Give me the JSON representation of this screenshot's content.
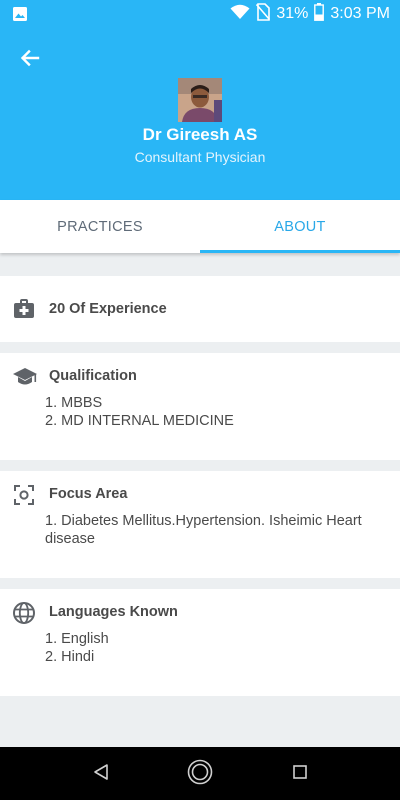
{
  "status_bar": {
    "battery": "31%",
    "time": "3:03 PM",
    "icons": [
      "image-icon",
      "wifi-icon",
      "no-sim-icon",
      "battery-icon"
    ]
  },
  "header": {
    "back_icon": "arrow-left-icon",
    "doctor_name": "Dr Gireesh AS",
    "doctor_title": "Consultant Physician",
    "background_color": "#29b6f6"
  },
  "tabs": [
    {
      "label": "PRACTICES",
      "active": false
    },
    {
      "label": "ABOUT",
      "active": true
    }
  ],
  "about": {
    "experience": {
      "icon": "medical-kit-icon",
      "text": "20 Of Experience"
    },
    "qualification": {
      "icon": "graduation-cap-icon",
      "title": "Qualification",
      "items": [
        "1. MBBS",
        "2. MD INTERNAL MEDICINE"
      ]
    },
    "focus_area": {
      "icon": "focus-icon",
      "title": "Focus Area",
      "items": [
        "1. Diabetes Mellitus.Hypertension. Isheimic Heart disease"
      ]
    },
    "languages": {
      "icon": "globe-icon",
      "title": "Languages Known",
      "items": [
        "1. English",
        "2. Hindi"
      ]
    }
  },
  "nav_bar": {
    "icons": [
      "nav-back-icon",
      "nav-home-icon",
      "nav-recent-icon"
    ]
  }
}
